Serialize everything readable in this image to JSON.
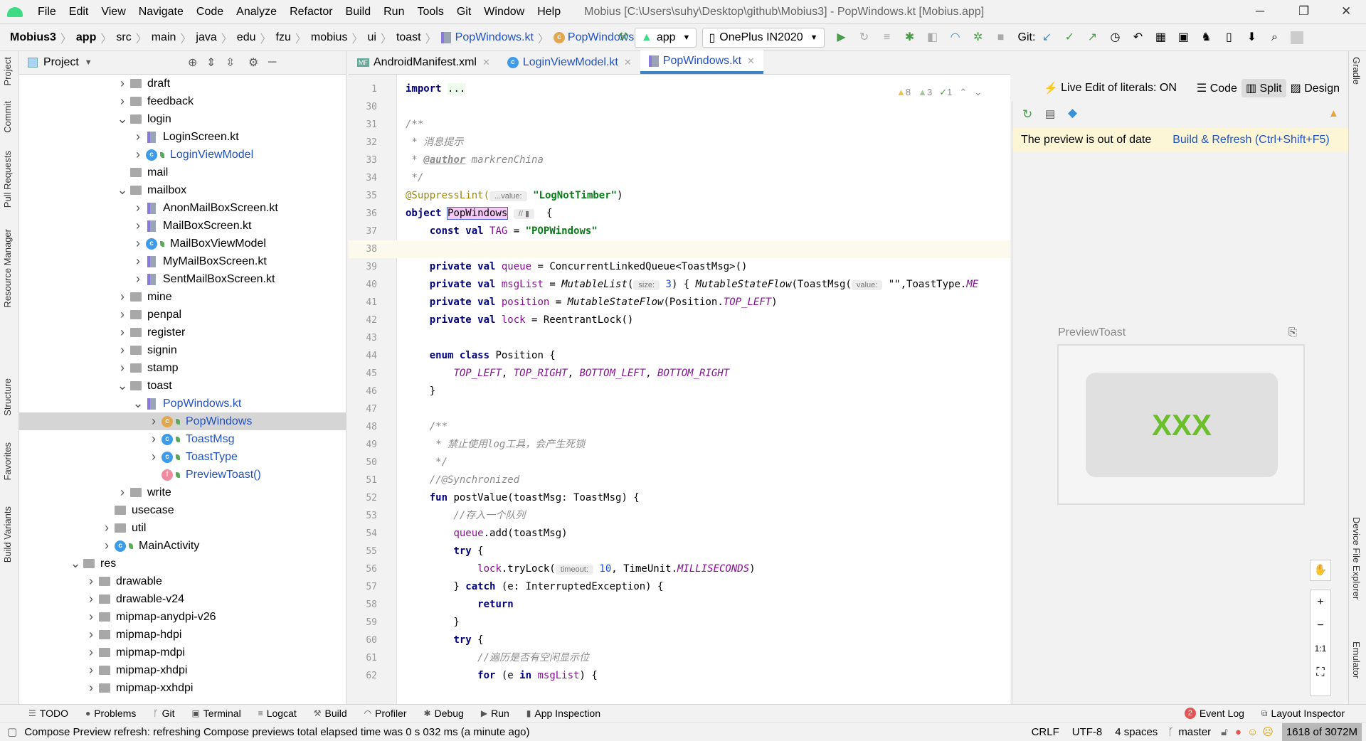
{
  "title_bar": {
    "menus": [
      "File",
      "Edit",
      "View",
      "Navigate",
      "Code",
      "Analyze",
      "Refactor",
      "Build",
      "Run",
      "Tools",
      "Git",
      "Window",
      "Help"
    ],
    "window_title": "Mobius [C:\\Users\\suhy\\Desktop\\github\\Mobius3] - PopWindows.kt [Mobius.app]"
  },
  "breadcrumb": [
    "Mobius3",
    "app",
    "src",
    "main",
    "java",
    "edu",
    "fzu",
    "mobius",
    "ui",
    "toast",
    "PopWindows.kt",
    "PopWindows"
  ],
  "toolbar": {
    "run_config": "app",
    "device": "OnePlus IN2020",
    "git_label": "Git:"
  },
  "left_strip": [
    "Project",
    "Commit",
    "Pull Requests",
    "Resource Manager",
    "Structure",
    "Favorites",
    "Build Variants"
  ],
  "right_strip": [
    "Gradle",
    "Device File Explorer",
    "Emulator"
  ],
  "project": {
    "title": "Project",
    "items": [
      {
        "label": "draft",
        "level": 3,
        "type": "folder",
        "arrow": "right"
      },
      {
        "label": "feedback",
        "level": 3,
        "type": "folder",
        "arrow": "right"
      },
      {
        "label": "login",
        "level": 3,
        "type": "folder",
        "arrow": "down"
      },
      {
        "label": "LoginScreen.kt",
        "level": 4,
        "type": "kt",
        "arrow": "right"
      },
      {
        "label": "LoginViewModel",
        "level": 4,
        "type": "class",
        "arrow": "right",
        "blue": true
      },
      {
        "label": "mail",
        "level": 3,
        "type": "folder",
        "arrow": ""
      },
      {
        "label": "mailbox",
        "level": 3,
        "type": "folder",
        "arrow": "down"
      },
      {
        "label": "AnonMailBoxScreen.kt",
        "level": 4,
        "type": "kt",
        "arrow": "right"
      },
      {
        "label": "MailBoxScreen.kt",
        "level": 4,
        "type": "kt",
        "arrow": "right"
      },
      {
        "label": "MailBoxViewModel",
        "level": 4,
        "type": "class",
        "arrow": "right"
      },
      {
        "label": "MyMailBoxScreen.kt",
        "level": 4,
        "type": "kt",
        "arrow": "right"
      },
      {
        "label": "SentMailBoxScreen.kt",
        "level": 4,
        "type": "kt",
        "arrow": "right"
      },
      {
        "label": "mine",
        "level": 3,
        "type": "folder",
        "arrow": "right"
      },
      {
        "label": "penpal",
        "level": 3,
        "type": "folder",
        "arrow": "right"
      },
      {
        "label": "register",
        "level": 3,
        "type": "folder",
        "arrow": "right"
      },
      {
        "label": "signin",
        "level": 3,
        "type": "folder",
        "arrow": "right"
      },
      {
        "label": "stamp",
        "level": 3,
        "type": "folder",
        "arrow": "right"
      },
      {
        "label": "toast",
        "level": 3,
        "type": "folder",
        "arrow": "down"
      },
      {
        "label": "PopWindows.kt",
        "level": 4,
        "type": "kt",
        "arrow": "down",
        "blue": true
      },
      {
        "label": "PopWindows",
        "level": 5,
        "type": "object",
        "arrow": "right",
        "blue": true,
        "selected": true
      },
      {
        "label": "ToastMsg",
        "level": 5,
        "type": "class",
        "arrow": "right",
        "blue": true
      },
      {
        "label": "ToastType",
        "level": 5,
        "type": "class",
        "arrow": "right",
        "blue": true
      },
      {
        "label": "PreviewToast()",
        "level": 5,
        "type": "function",
        "arrow": "",
        "blue": true
      },
      {
        "label": "write",
        "level": 3,
        "type": "folder",
        "arrow": "right"
      },
      {
        "label": "usecase",
        "level": 2,
        "type": "folder",
        "arrow": ""
      },
      {
        "label": "util",
        "level": 2,
        "type": "folder",
        "arrow": "right"
      },
      {
        "label": "MainActivity",
        "level": 2,
        "type": "class",
        "arrow": "right"
      },
      {
        "label": "res",
        "level": 0,
        "type": "folder",
        "arrow": "down"
      },
      {
        "label": "drawable",
        "level": 1,
        "type": "folder",
        "arrow": "right"
      },
      {
        "label": "drawable-v24",
        "level": 1,
        "type": "folder",
        "arrow": "right"
      },
      {
        "label": "mipmap-anydpi-v26",
        "level": 1,
        "type": "folder",
        "arrow": "right"
      },
      {
        "label": "mipmap-hdpi",
        "level": 1,
        "type": "folder",
        "arrow": "right"
      },
      {
        "label": "mipmap-mdpi",
        "level": 1,
        "type": "folder",
        "arrow": "right"
      },
      {
        "label": "mipmap-xhdpi",
        "level": 1,
        "type": "folder",
        "arrow": "right"
      },
      {
        "label": "mipmap-xxhdpi",
        "level": 1,
        "type": "folder",
        "arrow": "right"
      }
    ]
  },
  "editor": {
    "tabs": [
      {
        "label": "AndroidManifest.xml",
        "active": false
      },
      {
        "label": "LoginViewModel.kt",
        "active": false
      },
      {
        "label": "PopWindows.kt",
        "active": true
      }
    ],
    "inspections": {
      "warnings": "8",
      "weak_warnings": "3",
      "typos": "1"
    },
    "lines": [
      {
        "n": "1",
        "t": [
          [
            "import",
            "kw"
          ],
          [
            " ",
            ""
          ],
          [
            "...",
            "ok"
          ]
        ]
      },
      {
        "n": "30",
        "t": []
      },
      {
        "n": "31",
        "t": [
          [
            "/**",
            "cm"
          ]
        ]
      },
      {
        "n": "32",
        "t": [
          [
            " * 消息提示",
            "cm"
          ]
        ]
      },
      {
        "n": "33",
        "t": [
          [
            " * ",
            "cm"
          ],
          [
            "@author",
            "docT"
          ],
          [
            " markrenChina",
            "cm"
          ]
        ]
      },
      {
        "n": "34",
        "t": [
          [
            " */",
            "cm"
          ]
        ]
      },
      {
        "n": "35",
        "t": [
          [
            "@SuppressLint(",
            "ann"
          ],
          [
            " ...value: ",
            "hint"
          ],
          [
            " ",
            ""
          ],
          [
            "\"LogNotTimber\"",
            "str"
          ],
          [
            ")",
            ""
          ]
        ]
      },
      {
        "n": "36",
        "t": [
          [
            "object",
            "kw"
          ],
          [
            " ",
            ""
          ],
          [
            "PopWindows",
            "hl"
          ],
          [
            " ",
            ""
          ],
          [
            " // ▮ ",
            "hint"
          ],
          [
            "  {",
            ""
          ]
        ]
      },
      {
        "n": "37",
        "t": [
          [
            "    ",
            ""
          ],
          [
            "const val",
            "kw"
          ],
          [
            " ",
            ""
          ],
          [
            "TAG",
            "prop"
          ],
          [
            " = ",
            ""
          ],
          [
            "\"POPWindows\"",
            "str"
          ]
        ]
      },
      {
        "n": "38",
        "t": [],
        "current": true
      },
      {
        "n": "39",
        "t": [
          [
            "    ",
            ""
          ],
          [
            "private val",
            "kw"
          ],
          [
            " ",
            ""
          ],
          [
            "queue",
            "prop"
          ],
          [
            " = ConcurrentLinkedQueue<ToastMsg>()",
            ""
          ]
        ]
      },
      {
        "n": "40",
        "t": [
          [
            "    ",
            ""
          ],
          [
            "private val",
            "kw"
          ],
          [
            " ",
            ""
          ],
          [
            "msgList",
            "prop"
          ],
          [
            " = ",
            ""
          ],
          [
            "MutableList",
            "it"
          ],
          [
            "(",
            ""
          ],
          [
            " size: ",
            "hint"
          ],
          [
            " ",
            ""
          ],
          [
            "3",
            "num"
          ],
          [
            ") { ",
            ""
          ],
          [
            "MutableStateFlow",
            "it"
          ],
          [
            "(ToastMsg(",
            ""
          ],
          [
            " value: ",
            "hint"
          ],
          [
            " \"\"",
            ""
          ],
          [
            ",ToastType.",
            ""
          ],
          [
            "ME",
            "cst"
          ]
        ]
      },
      {
        "n": "41",
        "t": [
          [
            "    ",
            ""
          ],
          [
            "private val",
            "kw"
          ],
          [
            " ",
            ""
          ],
          [
            "position",
            "prop"
          ],
          [
            " = ",
            ""
          ],
          [
            "MutableStateFlow",
            "it"
          ],
          [
            "(Position.",
            ""
          ],
          [
            "TOP_LEFT",
            "cst"
          ],
          [
            ")",
            ""
          ]
        ]
      },
      {
        "n": "42",
        "t": [
          [
            "    ",
            ""
          ],
          [
            "private val",
            "kw"
          ],
          [
            " ",
            ""
          ],
          [
            "lock",
            "prop"
          ],
          [
            " = ReentrantLock()",
            ""
          ]
        ]
      },
      {
        "n": "43",
        "t": []
      },
      {
        "n": "44",
        "t": [
          [
            "    ",
            ""
          ],
          [
            "enum class",
            "kw"
          ],
          [
            " Position {",
            ""
          ]
        ]
      },
      {
        "n": "45",
        "t": [
          [
            "        ",
            ""
          ],
          [
            "TOP_LEFT",
            "cst"
          ],
          [
            ", ",
            ""
          ],
          [
            "TOP_RIGHT",
            "cst"
          ],
          [
            ", ",
            ""
          ],
          [
            "BOTTOM_LEFT",
            "cst"
          ],
          [
            ", ",
            ""
          ],
          [
            "BOTTOM_RIGHT",
            "cst"
          ]
        ]
      },
      {
        "n": "46",
        "t": [
          [
            "    }",
            ""
          ]
        ]
      },
      {
        "n": "47",
        "t": []
      },
      {
        "n": "48",
        "t": [
          [
            "    /**",
            "cm"
          ]
        ]
      },
      {
        "n": "49",
        "t": [
          [
            "     * 禁止使用log工具，会产生死锁",
            "cm"
          ]
        ]
      },
      {
        "n": "50",
        "t": [
          [
            "     */",
            "cm"
          ]
        ]
      },
      {
        "n": "51",
        "t": [
          [
            "    //@Synchronized",
            "cm"
          ]
        ]
      },
      {
        "n": "52",
        "t": [
          [
            "    ",
            ""
          ],
          [
            "fun",
            "kw"
          ],
          [
            " postValue(toastMsg: ToastMsg) {",
            ""
          ]
        ]
      },
      {
        "n": "53",
        "t": [
          [
            "        //存入一个队列",
            "cm"
          ]
        ]
      },
      {
        "n": "54",
        "t": [
          [
            "        ",
            ""
          ],
          [
            "queue",
            "prop"
          ],
          [
            ".add(toastMsg)",
            ""
          ]
        ]
      },
      {
        "n": "55",
        "t": [
          [
            "        ",
            ""
          ],
          [
            "try",
            "kw"
          ],
          [
            " {",
            ""
          ]
        ]
      },
      {
        "n": "56",
        "t": [
          [
            "            ",
            ""
          ],
          [
            "lock",
            "prop"
          ],
          [
            ".tryLock(",
            ""
          ],
          [
            " timeout: ",
            "hint"
          ],
          [
            " ",
            ""
          ],
          [
            "10",
            "num"
          ],
          [
            ", TimeUnit.",
            ""
          ],
          [
            "MILLISECONDS",
            "cst"
          ],
          [
            ")",
            ""
          ]
        ]
      },
      {
        "n": "57",
        "t": [
          [
            "        } ",
            ""
          ],
          [
            "catch",
            "kw"
          ],
          [
            " (e: InterruptedException) {",
            ""
          ]
        ]
      },
      {
        "n": "58",
        "t": [
          [
            "            ",
            ""
          ],
          [
            "return",
            "kw"
          ]
        ]
      },
      {
        "n": "59",
        "t": [
          [
            "        }",
            ""
          ]
        ]
      },
      {
        "n": "60",
        "t": [
          [
            "        ",
            ""
          ],
          [
            "try",
            "kw"
          ],
          [
            " {",
            ""
          ]
        ]
      },
      {
        "n": "61",
        "t": [
          [
            "            //遍历是否有空闲显示位",
            "cm"
          ]
        ]
      },
      {
        "n": "62",
        "t": [
          [
            "            ",
            ""
          ],
          [
            "for",
            "kw"
          ],
          [
            " (e ",
            ""
          ],
          [
            "in",
            "kw"
          ],
          [
            " ",
            ""
          ],
          [
            "msgList",
            "prop"
          ],
          [
            ") {",
            ""
          ]
        ]
      }
    ]
  },
  "preview": {
    "live_edit": "Live Edit of literals: ON",
    "modes": [
      "Code",
      "Split",
      "Design"
    ],
    "active_mode": "Split",
    "banner_text": "The preview is out of date",
    "banner_action": "Build & Refresh (Ctrl+Shift+F5)",
    "component_label": "PreviewToast",
    "toast_text": "XXX",
    "toast_color": "#6abf2b",
    "zoom_controls": [
      "hand-icon",
      "+",
      "−",
      "1:1",
      "fit-icon"
    ]
  },
  "bottom_tools": [
    "TODO",
    "Problems",
    "Git",
    "Terminal",
    "Logcat",
    "Build",
    "Profiler",
    "Debug",
    "Run",
    "App Inspection"
  ],
  "bottom_right_tools": {
    "event_log": "Event Log",
    "event_count": "2",
    "layout_inspector": "Layout Inspector"
  },
  "status": {
    "message": "Compose Preview refresh: refreshing Compose previews total elapsed time was 0 s 032 ms (a minute ago)",
    "line_sep": "CRLF",
    "encoding": "UTF-8",
    "indent": "4 spaces",
    "branch": "master",
    "memory": "1618 of 3072M"
  }
}
